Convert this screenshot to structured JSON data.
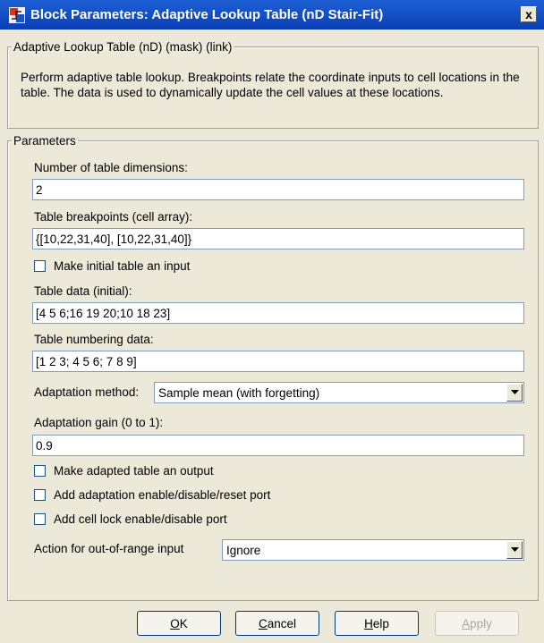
{
  "window": {
    "title": "Block Parameters: Adaptive Lookup Table (nD Stair-Fit)",
    "close_glyph": "x"
  },
  "block_group": {
    "legend": "Adaptive Lookup Table (nD) (mask) (link)",
    "description": "Perform adaptive table lookup.  Breakpoints relate the coordinate inputs to cell locations in the table.  The data is used to dynamically update the cell values at these locations."
  },
  "params": {
    "legend": "Parameters",
    "num_dims_label": "Number of table dimensions:",
    "num_dims_value": "2",
    "breakpoints_label": "Table breakpoints (cell array):",
    "breakpoints_value": "{[10,22,31,40], [10,22,31,40]}",
    "initial_input_label": "Make initial table an input",
    "table_data_label": "Table data (initial):",
    "table_data_value": "[4 5 6;16 19 20;10 18 23]",
    "numbering_label": "Table numbering data:",
    "numbering_value": "[1 2 3; 4 5 6; 7 8 9]",
    "adapt_method_label": "Adaptation method:",
    "adapt_method_value": "Sample mean (with forgetting)",
    "adapt_gain_label": "Adaptation gain (0 to 1):",
    "adapt_gain_value": "0.9",
    "adapted_output_label": "Make adapted table an output",
    "enable_port_label": "Add adaptation enable/disable/reset port",
    "lock_port_label": "Add cell lock enable/disable port",
    "out_of_range_label": "Action for out-of-range input",
    "out_of_range_value": "Ignore"
  },
  "buttons": {
    "ok_u": "O",
    "ok_rest": "K",
    "cancel_u": "C",
    "cancel_rest": "ancel",
    "help_u": "H",
    "help_rest": "elp",
    "apply_u": "A",
    "apply_rest": "pply"
  },
  "colors": {
    "titlebar": "#0a3fb3",
    "dialog_bg": "#ece9d8",
    "field_border": "#7f9db9"
  }
}
